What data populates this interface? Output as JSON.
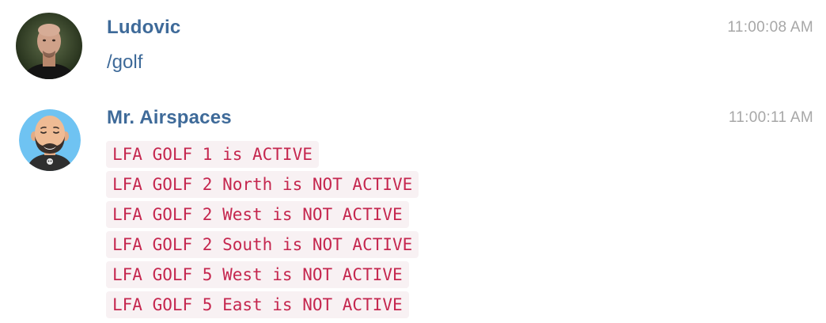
{
  "messages": [
    {
      "author": "Ludovic",
      "time": "11:00:08 AM",
      "text": "/golf",
      "avatar_icon": "user-photo-avatar"
    },
    {
      "author": "Mr. Airspaces",
      "time": "11:00:11 AM",
      "avatar_icon": "bearded-bot-avatar",
      "code_lines": [
        "LFA GOLF 1 is ACTIVE",
        "LFA GOLF 2 North is NOT ACTIVE",
        "LFA GOLF 2 West is NOT ACTIVE",
        "LFA GOLF 2 South is NOT ACTIVE",
        "LFA GOLF 5 West is NOT ACTIVE",
        "LFA GOLF 5 East is NOT ACTIVE"
      ]
    }
  ],
  "colors": {
    "author": "#3e6a99",
    "timestamp": "#a7a7a7",
    "code_text": "#c5274f",
    "code_bg": "#f8f1f3"
  }
}
